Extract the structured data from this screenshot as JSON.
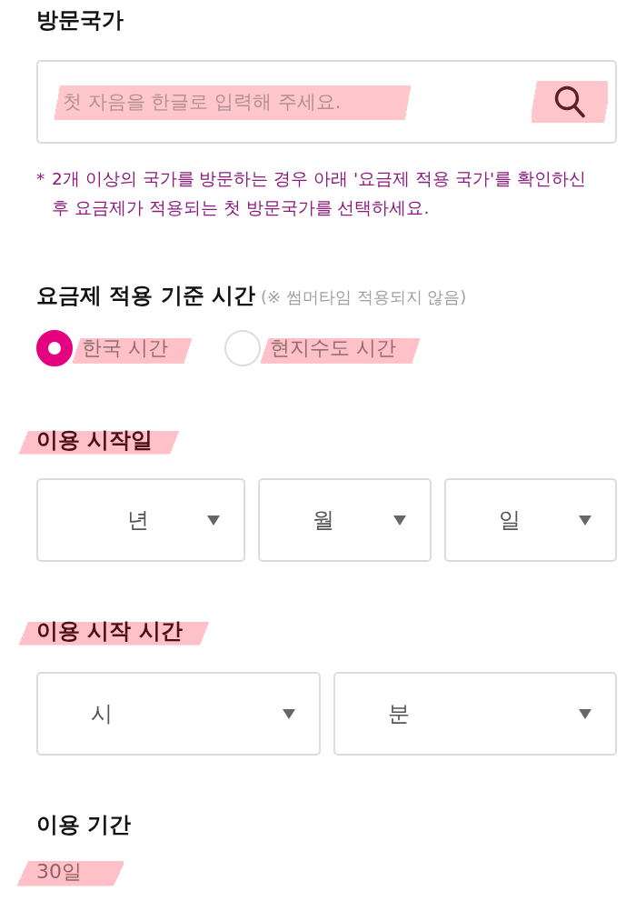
{
  "country_section": {
    "title": "방문국가",
    "highlighted": false,
    "search": {
      "placeholder": "첫 자음을 한글로 입력해 주세요.",
      "placeholder_highlighted": true,
      "button_highlighted": true
    },
    "note": {
      "mark": "*",
      "text": "2개 이상의 국가를 방문하는 경우 아래 '요금제 적용 국가'를 확인하신 후 요금제가 적용되는 첫 방문국가를 선택하세요."
    }
  },
  "time_basis": {
    "title": "요금제 적용 기준 시간",
    "highlighted": false,
    "hint": "(※ 썸머타임 적용되지 않음)",
    "options": [
      {
        "label": "한국 시간",
        "selected": true,
        "highlighted": true
      },
      {
        "label": "현지수도 시간",
        "selected": false,
        "highlighted": true
      }
    ]
  },
  "start_date": {
    "title": "이용 시작일",
    "highlighted": true,
    "selects": [
      {
        "unit": "년"
      },
      {
        "unit": "월"
      },
      {
        "unit": "일"
      }
    ]
  },
  "start_time": {
    "title": "이용 시작 시간",
    "highlighted": true,
    "selects": [
      {
        "unit": "시"
      },
      {
        "unit": "분"
      }
    ]
  },
  "period": {
    "title": "이용 기간",
    "highlighted": false,
    "value": "30일",
    "value_highlighted": true
  }
}
